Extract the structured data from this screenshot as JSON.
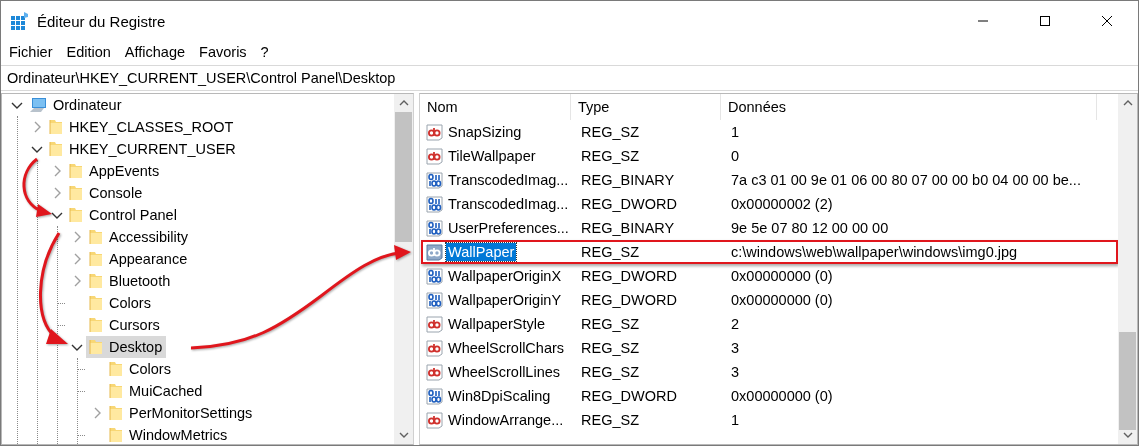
{
  "window": {
    "title": "Éditeur du Registre"
  },
  "menu": [
    "Fichier",
    "Edition",
    "Affichage",
    "Favoris",
    "?"
  ],
  "address": "Ordinateur\\HKEY_CURRENT_USER\\Control Panel\\Desktop",
  "tree": [
    {
      "label": "Ordinateur",
      "kind": "computer",
      "expandable": true,
      "expanded": true,
      "selected": false,
      "children": [
        {
          "label": "HKEY_CLASSES_ROOT",
          "kind": "folder",
          "expandable": true,
          "expanded": false,
          "selected": false
        },
        {
          "label": "HKEY_CURRENT_USER",
          "kind": "folder",
          "expandable": true,
          "expanded": true,
          "selected": false,
          "children": [
            {
              "label": "AppEvents",
              "kind": "folder",
              "expandable": true,
              "expanded": false,
              "selected": false
            },
            {
              "label": "Console",
              "kind": "folder",
              "expandable": true,
              "expanded": false,
              "selected": false
            },
            {
              "label": "Control Panel",
              "kind": "folder",
              "expandable": true,
              "expanded": true,
              "selected": false,
              "children": [
                {
                  "label": "Accessibility",
                  "kind": "folder",
                  "expandable": true,
                  "expanded": false,
                  "selected": false
                },
                {
                  "label": "Appearance",
                  "kind": "folder",
                  "expandable": true,
                  "expanded": false,
                  "selected": false
                },
                {
                  "label": "Bluetooth",
                  "kind": "folder",
                  "expandable": true,
                  "expanded": false,
                  "selected": false
                },
                {
                  "label": "Colors",
                  "kind": "folder",
                  "expandable": false,
                  "selected": false
                },
                {
                  "label": "Cursors",
                  "kind": "folder",
                  "expandable": false,
                  "selected": false
                },
                {
                  "label": "Desktop",
                  "kind": "folder",
                  "expandable": true,
                  "expanded": true,
                  "selected": true,
                  "children": [
                    {
                      "label": "Colors",
                      "kind": "folder",
                      "expandable": false,
                      "selected": false
                    },
                    {
                      "label": "MuiCached",
                      "kind": "folder",
                      "expandable": false,
                      "selected": false
                    },
                    {
                      "label": "PerMonitorSettings",
                      "kind": "folder",
                      "expandable": true,
                      "expanded": false,
                      "selected": false
                    },
                    {
                      "label": "WindowMetrics",
                      "kind": "folder",
                      "expandable": false,
                      "selected": false
                    }
                  ]
                }
              ]
            }
          ]
        }
      ]
    }
  ],
  "columns": [
    "Nom",
    "Type",
    "Données"
  ],
  "values": [
    {
      "name": "SnapSizing",
      "kind": "string",
      "type": "REG_SZ",
      "data": "1",
      "selected": false,
      "outlined": false
    },
    {
      "name": "TileWallpaper",
      "kind": "string",
      "type": "REG_SZ",
      "data": "0",
      "selected": false,
      "outlined": false
    },
    {
      "name": "TranscodedImag...",
      "kind": "binary",
      "type": "REG_BINARY",
      "data": "7a c3 01 00 9e 01 06 00 80 07 00 00 b0 04 00 00 be...",
      "selected": false,
      "outlined": false
    },
    {
      "name": "TranscodedImag...",
      "kind": "binary",
      "type": "REG_DWORD",
      "data": "0x00000002 (2)",
      "selected": false,
      "outlined": false
    },
    {
      "name": "UserPreferences...",
      "kind": "binary",
      "type": "REG_BINARY",
      "data": "9e 5e 07 80 12 00 00 00",
      "selected": false,
      "outlined": false
    },
    {
      "name": "WallPaper",
      "kind": "string",
      "type": "REG_SZ",
      "data": "c:\\windows\\web\\wallpaper\\windows\\img0.jpg",
      "selected": true,
      "outlined": true
    },
    {
      "name": "WallpaperOriginX",
      "kind": "binary",
      "type": "REG_DWORD",
      "data": "0x00000000 (0)",
      "selected": false,
      "outlined": false
    },
    {
      "name": "WallpaperOriginY",
      "kind": "binary",
      "type": "REG_DWORD",
      "data": "0x00000000 (0)",
      "selected": false,
      "outlined": false
    },
    {
      "name": "WallpaperStyle",
      "kind": "string",
      "type": "REG_SZ",
      "data": "2",
      "selected": false,
      "outlined": false
    },
    {
      "name": "WheelScrollChars",
      "kind": "string",
      "type": "REG_SZ",
      "data": "3",
      "selected": false,
      "outlined": false
    },
    {
      "name": "WheelScrollLines",
      "kind": "string",
      "type": "REG_SZ",
      "data": "3",
      "selected": false,
      "outlined": false
    },
    {
      "name": "Win8DpiScaling",
      "kind": "binary",
      "type": "REG_DWORD",
      "data": "0x00000000 (0)",
      "selected": false,
      "outlined": false
    },
    {
      "name": "WindowArrange...",
      "kind": "string",
      "type": "REG_SZ",
      "data": "1",
      "selected": false,
      "outlined": false
    }
  ]
}
